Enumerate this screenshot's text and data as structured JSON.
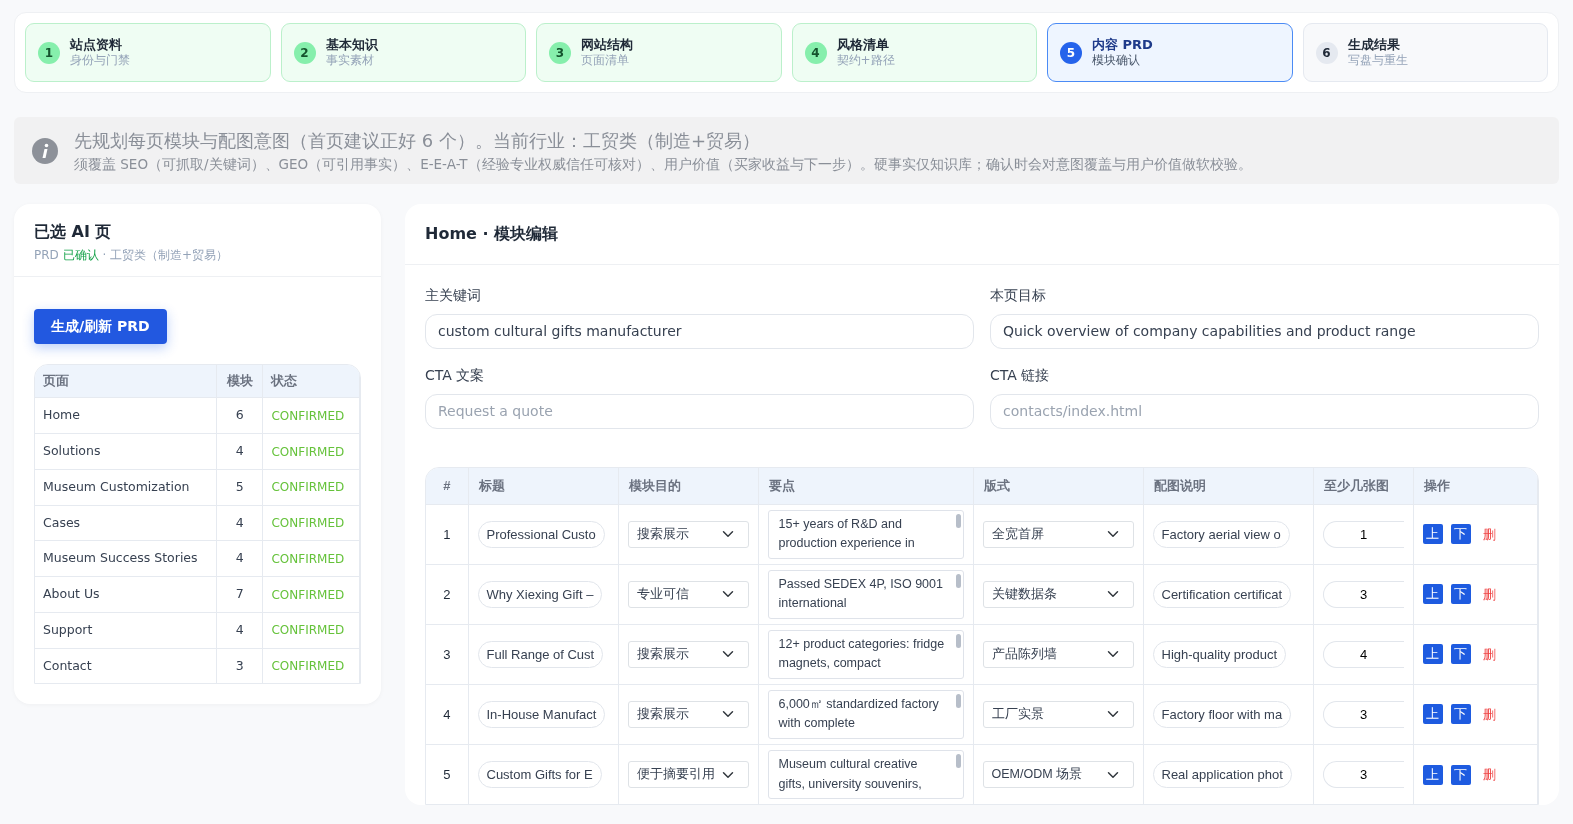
{
  "steps": [
    {
      "number": "1",
      "title": "站点资料",
      "subtitle": "身份与门禁",
      "done": true,
      "selected": false
    },
    {
      "number": "2",
      "title": "基本知识",
      "subtitle": "事实素材",
      "done": true,
      "selected": false
    },
    {
      "number": "3",
      "title": "网站结构",
      "subtitle": "页面清单",
      "done": true,
      "selected": false
    },
    {
      "number": "4",
      "title": "风格清单",
      "subtitle": "契约+路径",
      "done": true,
      "selected": false
    },
    {
      "number": "5",
      "title": "内容 PRD",
      "subtitle": "模块确认",
      "done": false,
      "selected": true
    },
    {
      "number": "6",
      "title": "生成结果",
      "subtitle": "写盘与重生",
      "done": false,
      "selected": false
    }
  ],
  "notice": {
    "title": "先规划每页模块与配图意图（首页建议正好 6 个）。当前行业：工贸类（制造+贸易）",
    "body": "须覆盖 SEO（可抓取/关键词）、GEO（可引用事实）、E-E-A-T（经验专业权威信任可核对）、用户价值（买家收益与下一步）。硬事实仅知识库；确认时会对意图覆盖与用户价值做软校验。"
  },
  "sidebar": {
    "title": "已选 AI 页",
    "subtitle_prefix": "PRD",
    "subtitle_status": "已确认",
    "subtitle_suffix": "· 工贸类（制造+贸易）",
    "button": "生成/刷新 PRD",
    "columns": [
      "页面",
      "模块",
      "状态"
    ],
    "rows": [
      {
        "page": "Home",
        "modules": "6",
        "status": "CONFIRMED"
      },
      {
        "page": "Solutions",
        "modules": "4",
        "status": "CONFIRMED"
      },
      {
        "page": "Museum Customization",
        "modules": "5",
        "status": "CONFIRMED"
      },
      {
        "page": "Cases",
        "modules": "4",
        "status": "CONFIRMED"
      },
      {
        "page": "Museum Success Stories",
        "modules": "4",
        "status": "CONFIRMED"
      },
      {
        "page": "About Us",
        "modules": "7",
        "status": "CONFIRMED"
      },
      {
        "page": "Support",
        "modules": "4",
        "status": "CONFIRMED"
      },
      {
        "page": "Contact",
        "modules": "3",
        "status": "CONFIRMED"
      }
    ]
  },
  "editor": {
    "title": "Home · 模块编辑",
    "fields": [
      {
        "label": "主关键词",
        "value": "custom cultural gifts manufacturer"
      },
      {
        "label": "本页目标",
        "value": "Quick overview of company capabilities and product range"
      },
      {
        "label": "CTA 文案",
        "placeholder": "Request a quote"
      },
      {
        "label": "CTA 链接",
        "placeholder": "contacts/index.html"
      }
    ],
    "columns": [
      "#",
      "标题",
      "模块目的",
      "要点",
      "版式",
      "配图说明",
      "至少几张图",
      "操作"
    ],
    "rows": [
      {
        "index": "1",
        "title": "Professional Custo",
        "purpose": "搜索展示",
        "points": "15+ years of R&D and production experience in",
        "layout": "全宽首屏",
        "image_note": "Factory aerial view o",
        "min_images": "1",
        "up": "上",
        "down": "下",
        "delete": "删"
      },
      {
        "index": "2",
        "title": "Why Xiexing Gift –",
        "purpose": "专业可信",
        "points": "Passed SEDEX 4P, ISO 9001 international",
        "layout": "关键数据条",
        "image_note": "Certification certificat",
        "min_images": "3",
        "up": "上",
        "down": "下",
        "delete": "删"
      },
      {
        "index": "3",
        "title": "Full Range of Cust",
        "purpose": "搜索展示",
        "points": "12+ product categories: fridge magnets, compact",
        "layout": "产品陈列墙",
        "image_note": "High-quality product",
        "min_images": "4",
        "up": "上",
        "down": "下",
        "delete": "删"
      },
      {
        "index": "4",
        "title": "In-House Manufact",
        "purpose": "搜索展示",
        "points": "6,000㎡ standardized factory with complete",
        "layout": "工厂实景",
        "image_note": "Factory floor with ma",
        "min_images": "3",
        "up": "上",
        "down": "下",
        "delete": "删"
      },
      {
        "index": "5",
        "title": "Custom Gifts for E",
        "purpose": "便于摘要引用",
        "points": "Museum cultural creative gifts, university souvenirs,",
        "layout": "OEM/ODM 场景",
        "image_note": "Real application phot",
        "min_images": "3",
        "up": "上",
        "down": "下",
        "delete": "删"
      }
    ]
  }
}
